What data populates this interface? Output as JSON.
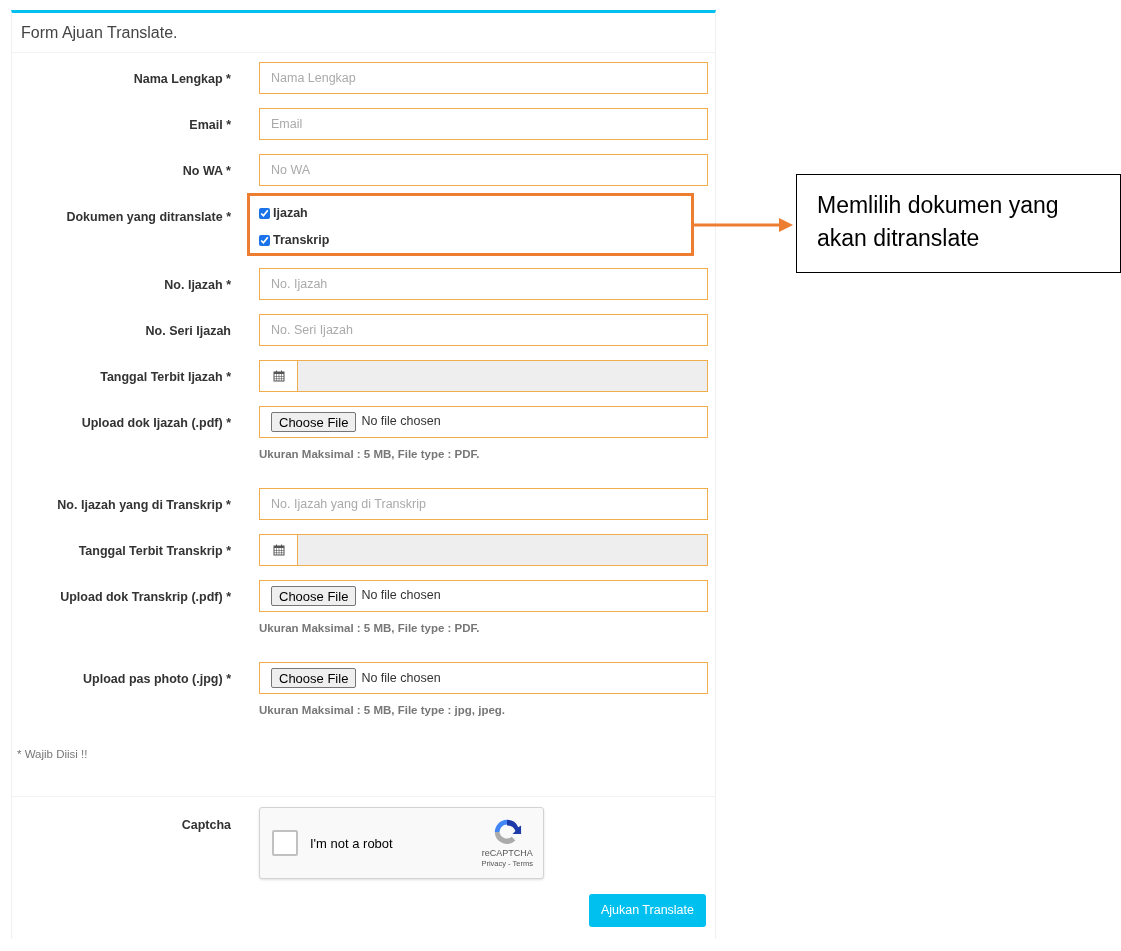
{
  "form": {
    "title": "Form Ajuan Translate.",
    "fields": [
      {
        "kind": "text",
        "label": "Nama Lengkap *",
        "placeholder": "Nama Lengkap"
      },
      {
        "kind": "text",
        "label": "Email *",
        "placeholder": "Email"
      },
      {
        "kind": "text",
        "label": "No WA *",
        "placeholder": "No WA"
      },
      {
        "kind": "checkboxes",
        "label": "Dokumen yang ditranslate *",
        "highlighted": true,
        "options": [
          {
            "label": "Ijazah",
            "checked": true
          },
          {
            "label": "Transkrip",
            "checked": true
          }
        ]
      },
      {
        "kind": "text",
        "label": "No. Ijazah *",
        "placeholder": "No. Ijazah"
      },
      {
        "kind": "text",
        "label": "No. Seri Ijazah",
        "placeholder": "No. Seri Ijazah"
      },
      {
        "kind": "date",
        "label": "Tanggal Terbit Ijazah *"
      },
      {
        "kind": "file",
        "label": "Upload dok Ijazah (.pdf) *",
        "button": "Choose File",
        "status": "No file chosen",
        "help": "Ukuran Maksimal : 5 MB, File type : PDF."
      },
      {
        "kind": "text",
        "label": "No. Ijazah yang di Transkrip *",
        "placeholder": "No. Ijazah yang di Transkrip"
      },
      {
        "kind": "date",
        "label": "Tanggal Terbit Transkrip *"
      },
      {
        "kind": "file",
        "label": "Upload dok Transkrip (.pdf) *",
        "button": "Choose File",
        "status": "No file chosen",
        "help": "Ukuran Maksimal : 5 MB, File type : PDF."
      },
      {
        "kind": "file",
        "label": "Upload pas photo (.jpg) *",
        "button": "Choose File",
        "status": "No file chosen",
        "help": "Ukuran Maksimal : 5 MB, File type : jpg, jpeg."
      }
    ],
    "note": "* Wajib Diisi !!",
    "captcha": {
      "label": "Captcha",
      "checked": false,
      "text": "I'm not a robot",
      "brand": "reCAPTCHA",
      "links": "Privacy - Terms"
    },
    "submit": "Ajukan Translate"
  },
  "annotation": {
    "text": "Memlilih dokumen yang akan ditranslate"
  }
}
